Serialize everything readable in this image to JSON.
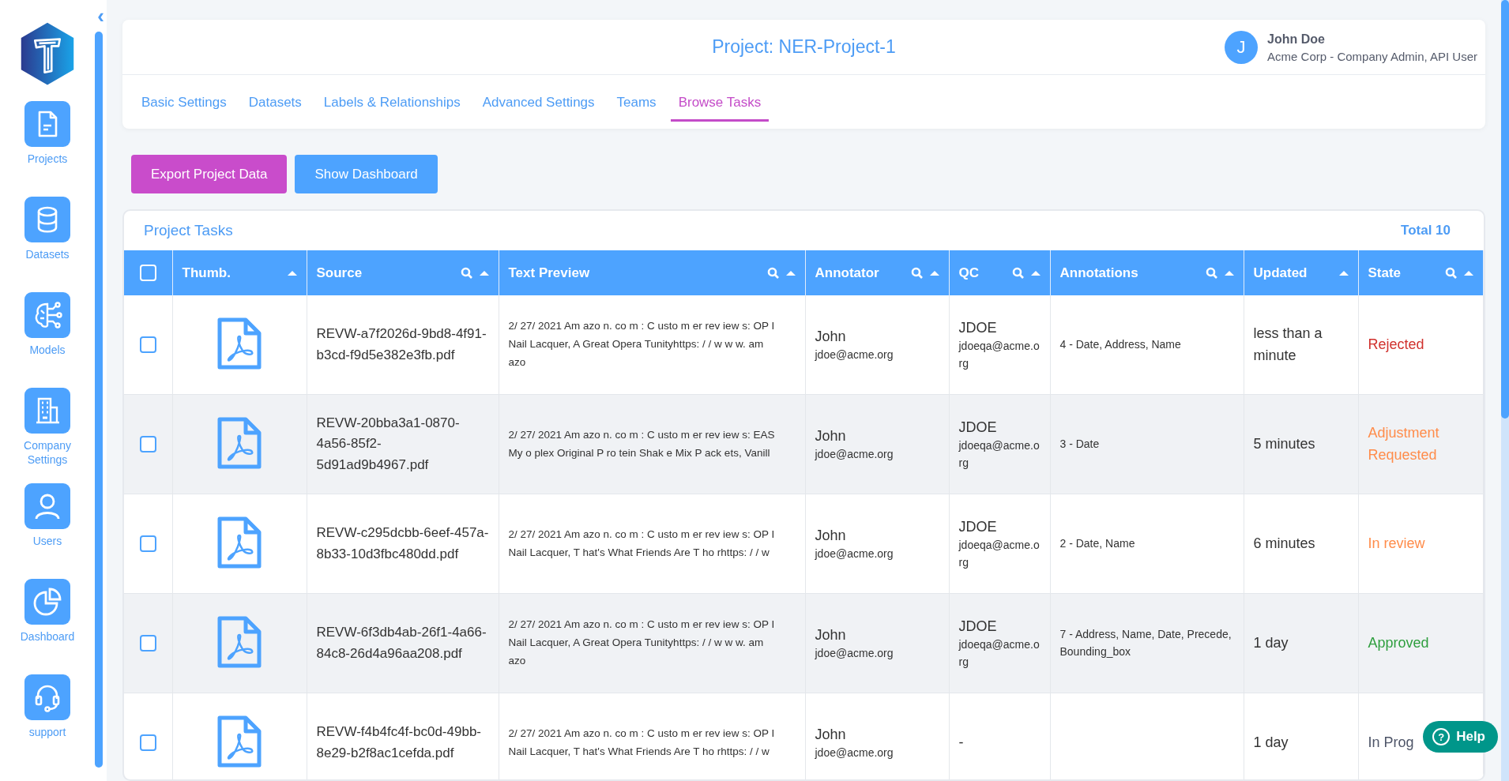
{
  "sidebar": {
    "collapse_icon": "‹",
    "items": [
      {
        "label": "Projects"
      },
      {
        "label": "Datasets"
      },
      {
        "label": "Models"
      },
      {
        "label": "Company Settings"
      },
      {
        "label": "Users"
      },
      {
        "label": "Dashboard"
      },
      {
        "label": "support"
      }
    ]
  },
  "header": {
    "title": "Project: NER-Project-1",
    "user": {
      "initial": "J",
      "name": "John Doe",
      "role": "Acme Corp - Company Admin, API User"
    },
    "tabs": [
      {
        "label": "Basic Settings",
        "selected": false
      },
      {
        "label": "Datasets",
        "selected": false
      },
      {
        "label": "Labels & Relationships",
        "selected": false
      },
      {
        "label": "Advanced Settings",
        "selected": false
      },
      {
        "label": "Teams",
        "selected": false
      },
      {
        "label": "Browse Tasks",
        "selected": true
      }
    ]
  },
  "actions": [
    {
      "label": "Export Project Data",
      "kind": "primary"
    },
    {
      "label": "Show Dashboard",
      "kind": "secondary"
    }
  ],
  "table": {
    "title": "Project Tasks",
    "total": "Total 10",
    "select_all": {
      "checked": false
    },
    "columns": [
      {
        "label": "Thumb.",
        "search": false
      },
      {
        "label": "Source",
        "search": true
      },
      {
        "label": "Text Preview",
        "search": true
      },
      {
        "label": "Annotator",
        "search": true
      },
      {
        "label": "QC",
        "search": true
      },
      {
        "label": "Annotations",
        "search": true
      },
      {
        "label": "Updated",
        "search": false
      },
      {
        "label": "State",
        "search": true
      }
    ],
    "rows": [
      {
        "checked": false,
        "source": "REVW-a7f2026d-9bd8-4f91-b3cd-f9d5e382e3fb.pdf",
        "preview": "2/ 27/ 2021 Am azo n. co m : C usto m er rev iew s: OP I Nail Lacquer, A Great Opera Tunityhttps: / / w w w. am azo",
        "annotator": "John",
        "annotator_email": "jdoe@acme.org",
        "qc": "JDOE",
        "qc_email": "jdoeqa@acme.org",
        "annotations": "4 - Date, Address, Name",
        "updated": "less than a minute",
        "state": "Rejected",
        "color": "#d0312d"
      },
      {
        "checked": false,
        "source": "REVW-20bba3a1-0870-4a56-85f2-5d91ad9b4967.pdf",
        "preview": "2/ 27/ 2021 Am azo n. co m : C usto m er rev iew s: EAS My o plex Original P ro tein Shak e Mix P ack ets, Vanill",
        "annotator": "John",
        "annotator_email": "jdoe@acme.org",
        "qc": "JDOE",
        "qc_email": "jdoeqa@acme.org",
        "annotations": "3 - Date",
        "updated": "5 minutes",
        "state": "Adjustment Requested",
        "color": "#ff8c4a"
      },
      {
        "checked": false,
        "source": "REVW-c295dcbb-6eef-457a-8b33-10d3fbc480dd.pdf",
        "preview": "2/ 27/ 2021 Am azo n. co m : C usto m er rev iew s: OP I Nail Lacquer, T hat's What Friends Are T ho rhttps: / / w",
        "annotator": "John",
        "annotator_email": "jdoe@acme.org",
        "qc": "JDOE",
        "qc_email": "jdoeqa@acme.org",
        "annotations": "2 - Date, Name",
        "updated": "6 minutes",
        "state": "In review",
        "color": "#ff8c4a"
      },
      {
        "checked": false,
        "source": "REVW-6f3db4ab-26f1-4a66-84c8-26d4a96aa208.pdf",
        "preview": "2/ 27/ 2021 Am azo n. co m : C usto m er rev iew s: OP I Nail Lacquer, A Great Opera Tunityhttps: / / w w w. am azo",
        "annotator": "John",
        "annotator_email": "jdoe@acme.org",
        "qc": "JDOE",
        "qc_email": "jdoeqa@acme.org",
        "annotations": "7 - Address, Name, Date, Precede, Bounding_box",
        "updated": "1 day",
        "state": "Approved",
        "color": "#2e9e3e"
      },
      {
        "checked": false,
        "source": "REVW-f4b4fc4f-bc0d-49bb-8e29-b2f8ac1cefda.pdf",
        "preview": "2/ 27/ 2021 Am azo n. co m : C usto m er rev iew s: OP I Nail Lacquer, T hat's What Friends Are T ho rhttps: / / w",
        "annotator": "John",
        "annotator_email": "jdoe@acme.org",
        "qc": "-",
        "annotations": "",
        "updated": "1 day",
        "state": "In Prog",
        "color": "#4e5568"
      }
    ]
  },
  "help": {
    "label": "Help",
    "icon": "?"
  }
}
